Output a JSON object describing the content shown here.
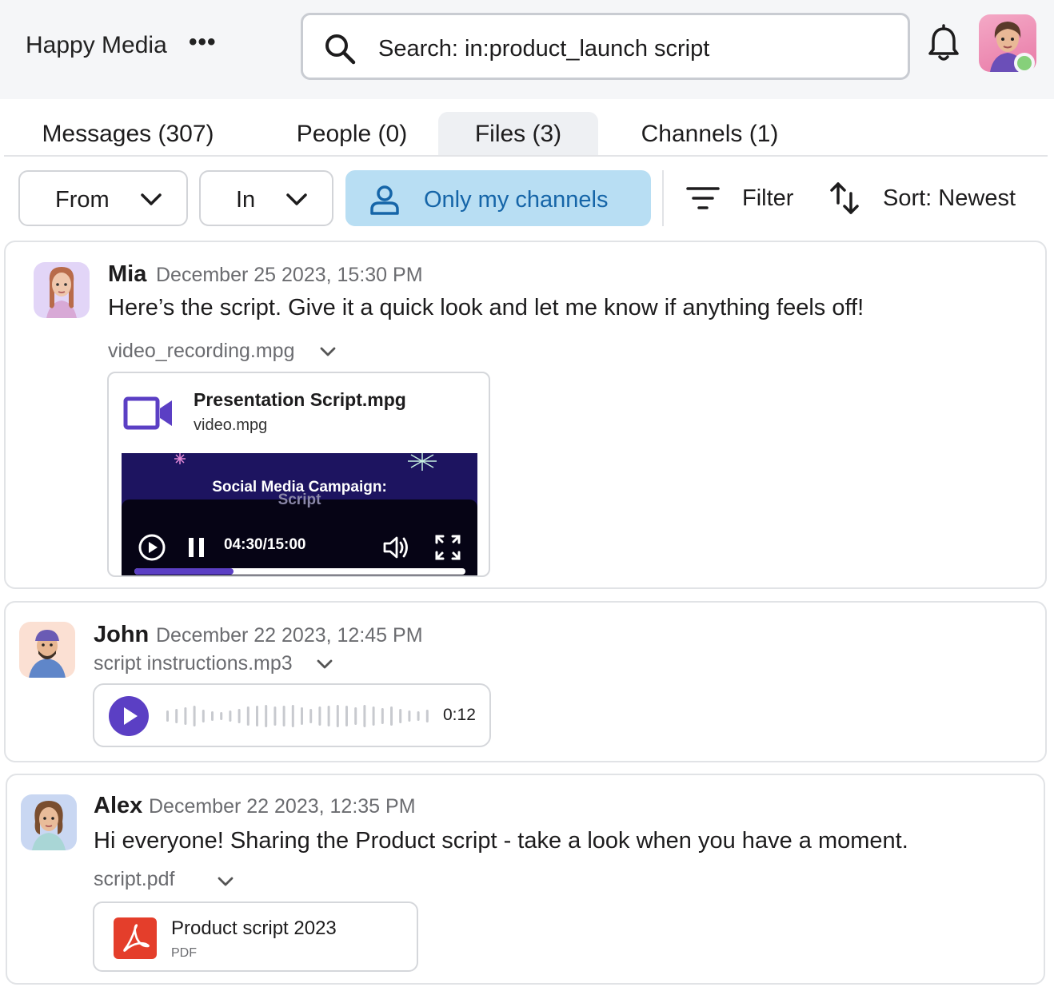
{
  "workspace": {
    "name": "Happy Media",
    "more": "•••"
  },
  "search": {
    "value": "Search: in:product_launch script"
  },
  "tabs": [
    {
      "label": "Messages (307)"
    },
    {
      "label": "People (0)"
    },
    {
      "label": "Files (3)",
      "active": true
    },
    {
      "label": "Channels (1)"
    }
  ],
  "filters": {
    "from_label": "From",
    "in_label": "In",
    "only_mine_label": "Only my channels",
    "filter_label": "Filter",
    "sort_label": "Sort: Newest"
  },
  "colors": {
    "accent": "#5b3fc4",
    "chip_active_bg": "#b8def3",
    "chip_active_text": "#1565a8",
    "pdf_red": "#e43e2b",
    "presence": "#86d07a"
  },
  "results": [
    {
      "author": "Mia",
      "time": "December 25 2023, 15:30 PM",
      "text": "Here’s the script. Give it a quick look and let me know if anything feels off!",
      "file_name": "video_recording.mpg",
      "attachment": {
        "kind": "video",
        "icon": "video-camera-icon",
        "title": "Presentation Script.mpg",
        "subtitle": "video.mpg",
        "frame_title": "Social Media Campaign:",
        "frame_subtitle": "Script",
        "time": "04:30/15:00",
        "progress": 0.3
      }
    },
    {
      "author": "John",
      "time": "December 22 2023, 12:45 PM",
      "file_name": "script instructions.mp3",
      "attachment": {
        "kind": "audio",
        "icon": "play-icon",
        "duration": "0:12"
      }
    },
    {
      "author": "Alex",
      "time": "December 22 2023, 12:35 PM",
      "text": "Hi everyone! Sharing the Product script - take a look when you have a moment.",
      "file_name": "script.pdf",
      "attachment": {
        "kind": "pdf",
        "icon": "pdf-icon",
        "title": "Product script 2023",
        "subtitle": "PDF"
      }
    }
  ]
}
